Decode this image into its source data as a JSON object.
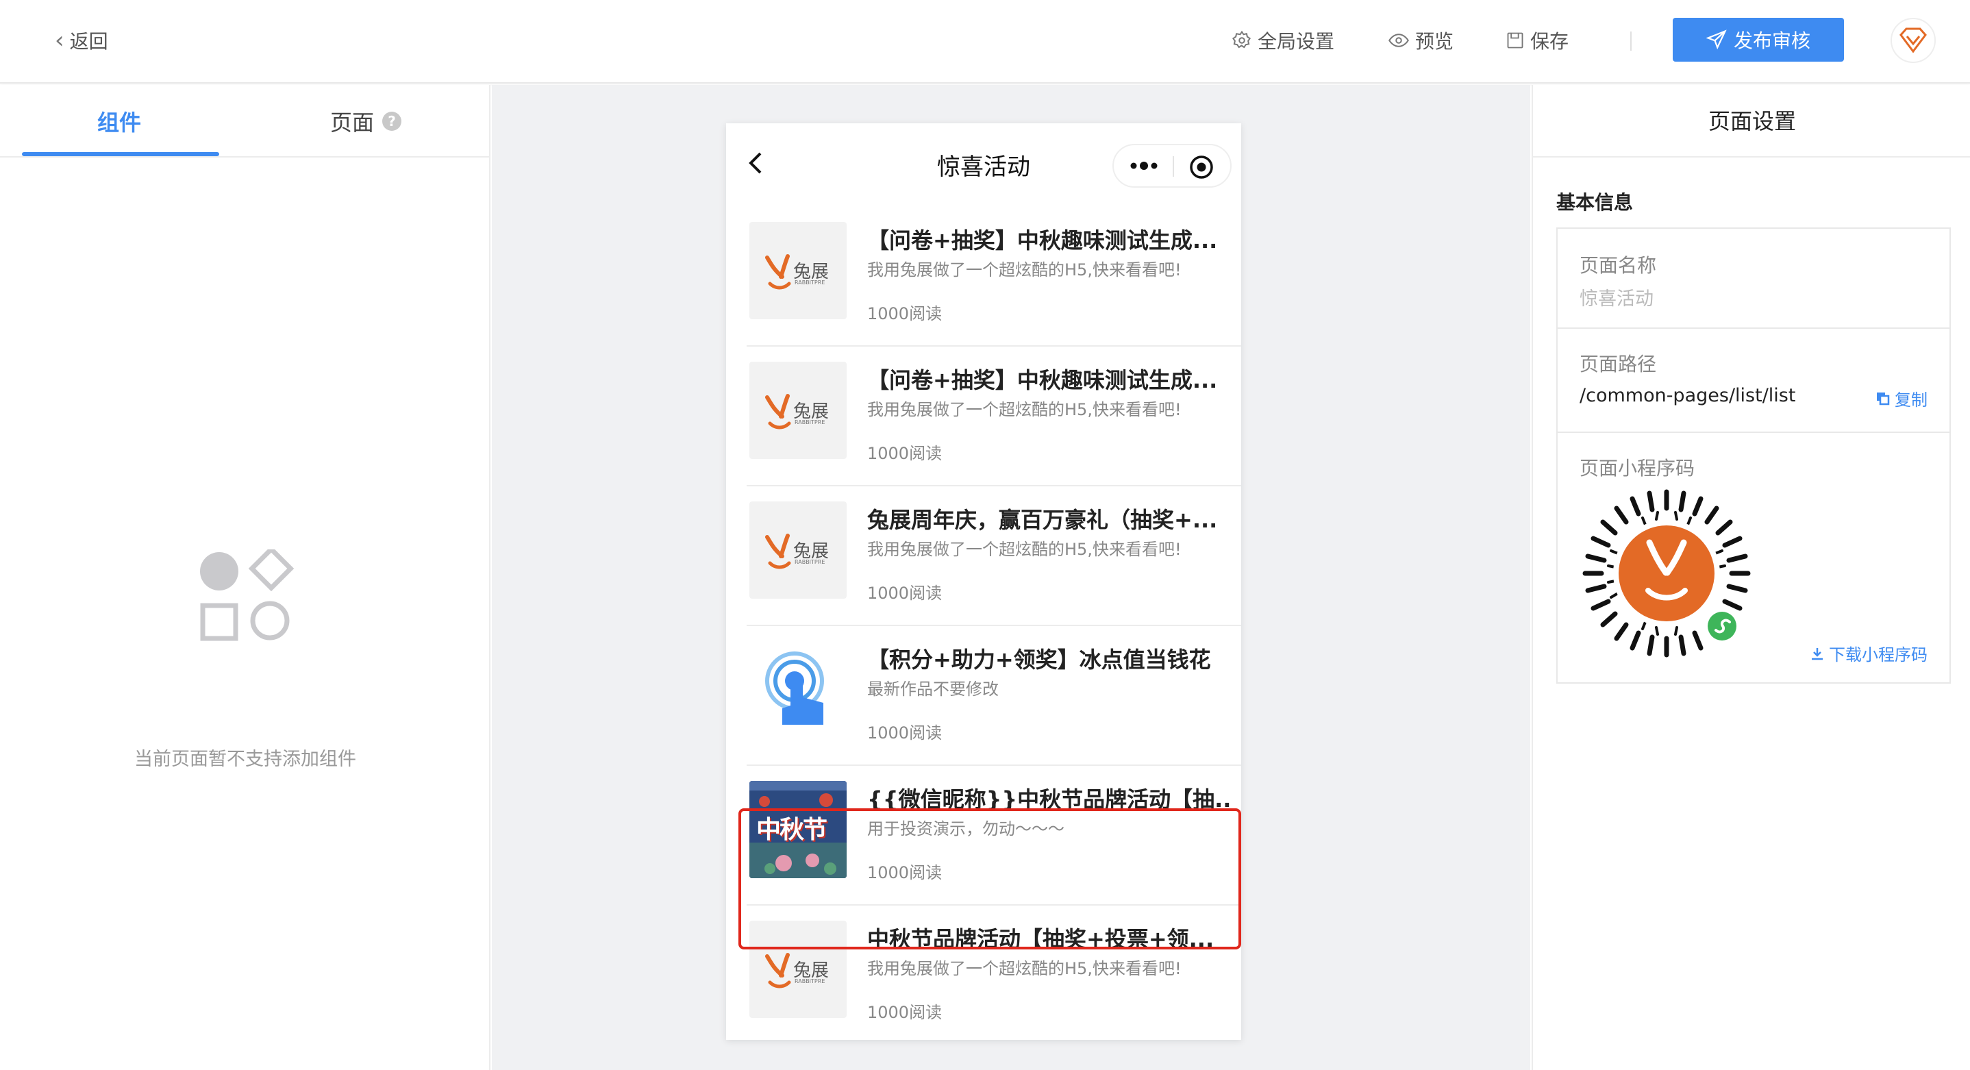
{
  "topbar": {
    "back_label": "返回",
    "global_settings_label": "全局设置",
    "preview_label": "预览",
    "save_label": "保存",
    "publish_label": "发布审核"
  },
  "left_panel": {
    "tabs": [
      {
        "label": "组件",
        "active": true
      },
      {
        "label": "页面",
        "active": false
      }
    ],
    "empty_message": "当前页面暂不支持添加组件"
  },
  "phone": {
    "title": "惊喜活动",
    "items": [
      {
        "title": "【问卷+抽奖】中秋趣味测试生成...",
        "desc": "我用兔展做了一个超炫酷的H5,快来看看吧!",
        "reads": "1000阅读",
        "thumb": "rabbitpre-logo",
        "logo_text": "兔展",
        "logo_sub": "RABBITPRE"
      },
      {
        "title": "【问卷+抽奖】中秋趣味测试生成...",
        "desc": "我用兔展做了一个超炫酷的H5,快来看看吧!",
        "reads": "1000阅读",
        "thumb": "rabbitpre-logo",
        "logo_text": "兔展",
        "logo_sub": "RABBITPRE"
      },
      {
        "title": "兔展周年庆，赢百万豪礼（抽奖+...",
        "desc": "我用兔展做了一个超炫酷的H5,快来看看吧!",
        "reads": "1000阅读",
        "thumb": "rabbitpre-logo",
        "logo_text": "兔展",
        "logo_sub": "RABBITPRE"
      },
      {
        "title": "【积分+助力+领奖】冰点值当钱花",
        "desc": "最新作品不要修改",
        "reads": "1000阅读",
        "thumb": "tap-icon"
      },
      {
        "title": "{{微信昵称}}中秋节品牌活动【抽...",
        "desc": "用于投资演示，勿动～～～",
        "reads": "1000阅读",
        "thumb": "mid-autumn-poster",
        "poster_text": "中秋节"
      },
      {
        "title": "中秋节品牌活动【抽奖+投票+领...",
        "desc": "我用兔展做了一个超炫酷的H5,快来看看吧!",
        "reads": "1000阅读",
        "thumb": "rabbitpre-logo",
        "logo_text": "兔展",
        "logo_sub": "RABBITPRE"
      }
    ]
  },
  "right_panel": {
    "header": "页面设置",
    "section_title": "基本信息",
    "page_name_label": "页面名称",
    "page_name_value": "惊喜活动",
    "page_path_label": "页面路径",
    "page_path_value": "/common-pages/list/list",
    "copy_label": "复制",
    "qrcode_label": "页面小程序码",
    "download_label": "下载小程序码"
  },
  "colors": {
    "accent": "#3e8bf1",
    "selection": "#e0271c",
    "brand_orange": "#e36a26"
  }
}
